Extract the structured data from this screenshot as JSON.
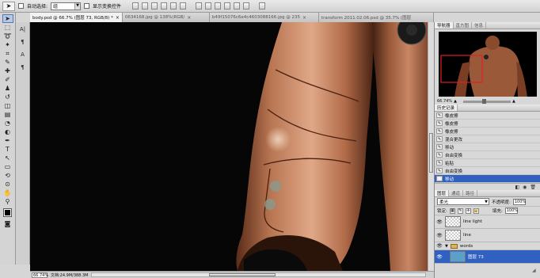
{
  "options_bar": {
    "tool_icon": "move-tool-icon",
    "auto_select_label": "自动选择:",
    "auto_select_value": "组",
    "show_transform_label": "显示变换控件"
  },
  "tabs": [
    {
      "label": "body.psd @ 66.7% (图层 73, RGB/8) *",
      "close": "×",
      "active": true
    },
    {
      "label": "0634168.jpg @ 138%(RGB/",
      "close": "×",
      "active": false
    },
    {
      "label": "b49f15076c6e4c4603088166.jpg @ 235",
      "close": "×",
      "active": false
    },
    {
      "label": "transform 2011.02.06.psd @ 35.7% (图层",
      "close": "×",
      "active": false
    }
  ],
  "toolbox": {
    "tools": [
      {
        "name": "move-tool-icon",
        "glyph": "➤"
      },
      {
        "name": "marquee-tool-icon",
        "glyph": "⬚"
      },
      {
        "name": "lasso-tool-icon",
        "glyph": "➰"
      },
      {
        "name": "magic-wand-icon",
        "glyph": "✦"
      },
      {
        "name": "crop-tool-icon",
        "glyph": "⌗"
      },
      {
        "name": "eyedropper-icon",
        "glyph": "✎"
      },
      {
        "name": "healing-brush-icon",
        "glyph": "✚"
      },
      {
        "name": "brush-tool-icon",
        "glyph": "✐"
      },
      {
        "name": "stamp-tool-icon",
        "glyph": "♟"
      },
      {
        "name": "history-brush-icon",
        "glyph": "↺"
      },
      {
        "name": "eraser-icon",
        "glyph": "◫"
      },
      {
        "name": "gradient-tool-icon",
        "glyph": "▤"
      },
      {
        "name": "blur-tool-icon",
        "glyph": "◔"
      },
      {
        "name": "dodge-tool-icon",
        "glyph": "◐"
      },
      {
        "name": "pen-tool-icon",
        "glyph": "✒"
      },
      {
        "name": "type-tool-icon",
        "glyph": "T"
      },
      {
        "name": "path-select-icon",
        "glyph": "↖"
      },
      {
        "name": "shape-tool-icon",
        "glyph": "▭"
      },
      {
        "name": "3d-rotate-icon",
        "glyph": "⟲"
      },
      {
        "name": "3d-orbit-icon",
        "glyph": "⊙"
      },
      {
        "name": "hand-tool-icon",
        "glyph": "✋"
      },
      {
        "name": "zoom-tool-icon",
        "glyph": "⚲"
      }
    ],
    "quickmask_icon": "◙"
  },
  "secondary_strip": [
    {
      "name": "char-panel-icon",
      "glyph": "A|"
    },
    {
      "name": "paragraph-panel-icon",
      "glyph": "¶"
    },
    {
      "name": "text-icon",
      "glyph": "A"
    },
    {
      "name": "pilcrow-icon",
      "glyph": "¶"
    }
  ],
  "status": {
    "zoom": "66.74%",
    "doc_size": "文档:24.9M/388.3M"
  },
  "navigator": {
    "tabs": [
      "导航器",
      "直方图",
      "信息"
    ],
    "zoom": "66.74%"
  },
  "history": {
    "title": "历史记录",
    "items": [
      {
        "label": "橡皮擦",
        "active": false
      },
      {
        "label": "橡皮擦",
        "active": false
      },
      {
        "label": "橡皮擦",
        "active": false
      },
      {
        "label": "混合更改",
        "active": false
      },
      {
        "label": "移动",
        "active": false
      },
      {
        "label": "自由变换",
        "active": false
      },
      {
        "label": "粘贴",
        "active": false
      },
      {
        "label": "自由变换",
        "active": false
      },
      {
        "label": "移动",
        "active": true
      }
    ]
  },
  "layers": {
    "tabs": [
      "图层",
      "通道",
      "路径"
    ],
    "blend_mode": "柔光",
    "opacity_label": "不透明度:",
    "opacity_value": "100%",
    "lock_label": "锁定:",
    "fill_label": "填充:",
    "fill_value": "100%",
    "items": [
      {
        "label": "line light",
        "type": "layer",
        "active": false
      },
      {
        "label": "line",
        "type": "layer",
        "active": false
      },
      {
        "label": "words",
        "type": "group",
        "active": false
      },
      {
        "label": "图层 73",
        "type": "layer",
        "active": true
      }
    ]
  }
}
